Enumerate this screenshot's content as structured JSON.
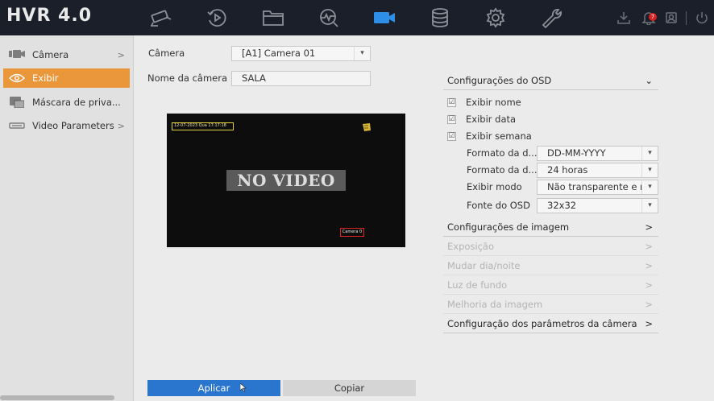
{
  "app": {
    "logo": "HVR 4.0",
    "notification_count": "7"
  },
  "topnav": [
    {
      "name": "live-view-icon"
    },
    {
      "name": "playback-icon"
    },
    {
      "name": "file-management-icon"
    },
    {
      "name": "smart-analysis-icon"
    },
    {
      "name": "camera-icon"
    },
    {
      "name": "storage-icon"
    },
    {
      "name": "system-settings-icon"
    },
    {
      "name": "maintenance-icon"
    }
  ],
  "sidebar": {
    "items": [
      {
        "label": "Câmera",
        "chevron": ">"
      },
      {
        "label": "Exibir"
      },
      {
        "label": "Máscara de priva..."
      },
      {
        "label": "Video Parameters",
        "chevron": ">"
      }
    ]
  },
  "form": {
    "camera_label": "Câmera",
    "camera_value": "[A1] Camera 01",
    "name_label": "Nome da câmera",
    "name_value": "SALA"
  },
  "preview": {
    "osd_datetime": "12-07-2023 Qua 17:17:18",
    "no_video": "NO VIDEO",
    "osd_name": "Camera 0"
  },
  "osd_section": {
    "title": "Configurações do OSD",
    "toggle": "⌄",
    "checks": [
      {
        "label": "Exibir nome",
        "checked": "☑"
      },
      {
        "label": "Exibir data",
        "checked": "☑"
      },
      {
        "label": "Exibir semana",
        "checked": "☑"
      }
    ],
    "fields": [
      {
        "label": "Formato da d...",
        "value": "DD-MM-YYYY"
      },
      {
        "label": "Formato da d...",
        "value": "24 horas"
      },
      {
        "label": "Exibir modo",
        "value": "Não transparente e n"
      },
      {
        "label": "Fonte do OSD",
        "value": "32x32"
      }
    ]
  },
  "sections": [
    {
      "label": "Configurações de imagem",
      "chevron": ">"
    },
    {
      "label": "Exposição",
      "chevron": ">"
    },
    {
      "label": "Mudar dia/noite",
      "chevron": ">"
    },
    {
      "label": "Luz de fundo",
      "chevron": ">"
    },
    {
      "label": "Melhoria da imagem",
      "chevron": ">"
    },
    {
      "label": "Configuração dos parâmetros da câmera",
      "chevron": ">"
    }
  ],
  "buttons": {
    "apply": "Aplicar",
    "copy": "Copiar"
  },
  "colors": {
    "topbar": "#1b1f29",
    "accent_active": "#2e8fe8",
    "sidebar_active": "#e9973a",
    "primary_button": "#2a75cd"
  }
}
